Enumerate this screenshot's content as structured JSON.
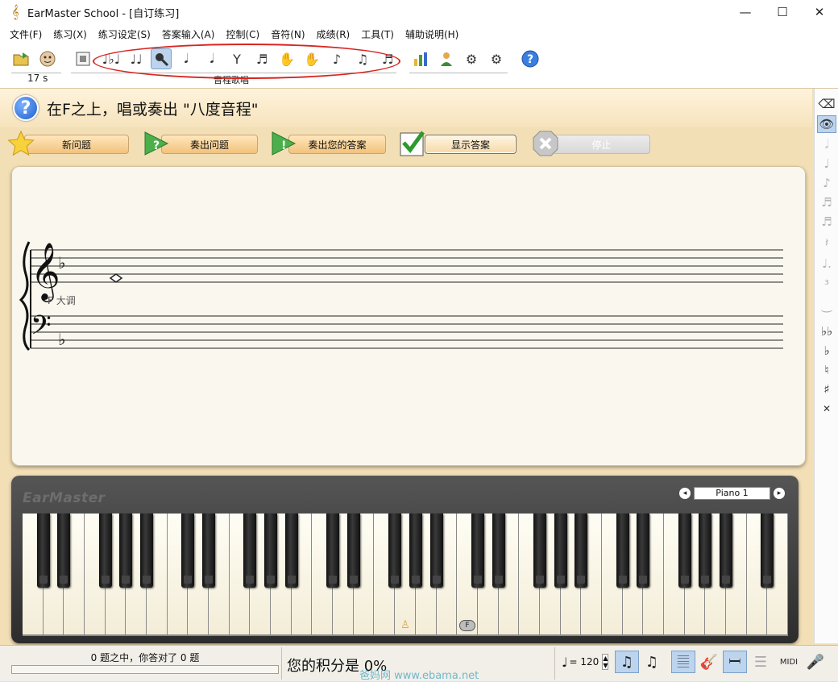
{
  "window": {
    "title": "EarMaster School - [自订练习]",
    "minimize": "—",
    "maximize": "☐",
    "close": "✕"
  },
  "menu": [
    "文件(F)",
    "练习(X)",
    "练习设定(S)",
    "答案输入(A)",
    "控制(C)",
    "音符(N)",
    "成绩(R)",
    "工具(T)",
    "辅助说明(H)"
  ],
  "toolbar": {
    "time_label": "17 s",
    "mode_label": "音程歌唱",
    "active_icon": "interval-singing-icon"
  },
  "question": {
    "text": "在F之上，唱或奏出 \"八度音程\""
  },
  "actions": {
    "new_question": "新问题",
    "play_question": "奏出问题",
    "play_answer": "奏出您的答案",
    "show_answer": "显示答案",
    "stop": "停止"
  },
  "score": {
    "key_label": "F 大调",
    "key_signature": "F major (1 flat)",
    "note": "F4 whole note (diamond)"
  },
  "keyboard": {
    "logo": "EarMaster",
    "instrument": "Piano 1",
    "instrument_prev": "◂",
    "instrument_next": "▸",
    "marked_key": "F"
  },
  "status": {
    "count_text": "0 题之中，你答对了 0 题",
    "progress": 0,
    "score_text": "您的积分是 0%",
    "watermark": "爸妈网 www.ebama.net",
    "tempo": "= 120"
  },
  "colors": {
    "accent": "#d7261f",
    "panel": "#faf7ee",
    "background": "#f3dfb6",
    "button": "#f2c27d"
  }
}
